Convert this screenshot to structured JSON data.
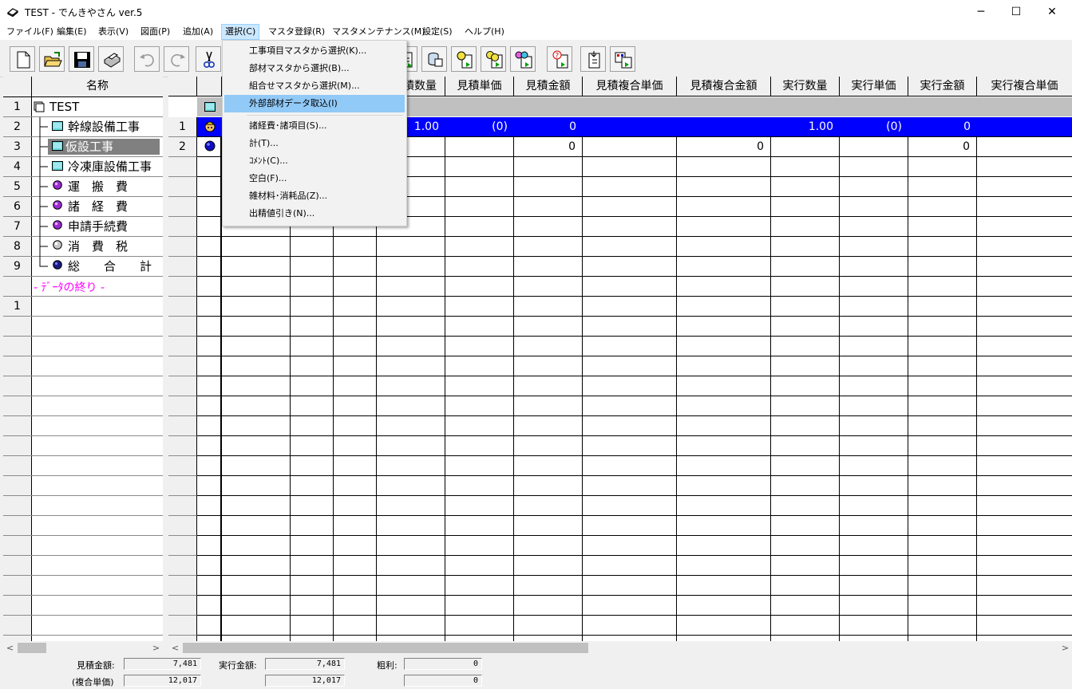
{
  "window": {
    "title": "TEST - でんきやさん ver.5",
    "controls": {
      "minimize": "─",
      "maximize": "☐",
      "close": "✕"
    }
  },
  "menubar": [
    {
      "label": "ファイル(F)"
    },
    {
      "label": "編集(E)"
    },
    {
      "label": "表示(V)"
    },
    {
      "label": "図面(P)"
    },
    {
      "label": "追加(A)"
    },
    {
      "label": "選択(C)"
    },
    {
      "label": "マスタ登録(R)"
    },
    {
      "label": "マスタメンテナンス(M)"
    },
    {
      "label": "設定(S)"
    },
    {
      "label": "ヘルプ(H)"
    }
  ],
  "dropdown": {
    "items": [
      "工事項目マスタから選択(K)...",
      "部材マスタから選択(B)...",
      "組合せマスタから選択(M)...",
      "外部部材データ取込(I)",
      "諸経費･諸項目(S)...",
      "計(T)...",
      "ｺﾒﾝﾄ(C)...",
      "空白(F)...",
      "雑材料･消耗品(Z)...",
      "出精値引き(N)..."
    ],
    "highlighted_index": 3
  },
  "tree": {
    "header": "名称",
    "rows": [
      {
        "num": "1",
        "label": "TEST",
        "icon": "document-icon"
      },
      {
        "num": "2",
        "label": "幹線設備工事",
        "icon": "folder-icon"
      },
      {
        "num": "3",
        "label": "仮設工事",
        "icon": "folder-icon",
        "selected": true
      },
      {
        "num": "4",
        "label": "冷凍庫設備工事",
        "icon": "folder-icon"
      },
      {
        "num": "5",
        "label": "運　搬　費",
        "icon": "purple-ball-icon"
      },
      {
        "num": "6",
        "label": "諸　経　費",
        "icon": "purple-ball-icon"
      },
      {
        "num": "7",
        "label": "申請手続費",
        "icon": "purple-ball-icon"
      },
      {
        "num": "8",
        "label": "消　費　税",
        "icon": "gray-ball-icon"
      },
      {
        "num": "9",
        "label": "総　　合　　計",
        "icon": "navy-ball-icon"
      }
    ],
    "end_label": "- ﾃﾞｰﾀの終り -",
    "after_rows": [
      "1"
    ]
  },
  "grid": {
    "columns": [
      "",
      "",
      "",
      "",
      "積数量",
      "見積単価",
      "見積金額",
      "見積複合単価",
      "見積複合金額",
      "実行数量",
      "実行単価",
      "実行金額",
      "実行複合単価"
    ],
    "rows": [
      {
        "num": "1",
        "selected": true,
        "cells": [
          "",
          "",
          "",
          "",
          "1.00",
          "(0)",
          "0",
          "",
          "",
          "1.00",
          "(0)",
          "0",
          ""
        ]
      },
      {
        "num": "2",
        "selected": false,
        "cells": [
          "",
          "",
          "",
          "",
          "",
          "",
          "0",
          "",
          "0",
          "",
          "",
          "0",
          ""
        ]
      }
    ]
  },
  "totals": {
    "estimate_label": "見積金額:",
    "estimate_value": "7,481",
    "composite_label": "(複合単価)",
    "composite_value": "12,017",
    "actual_label": "実行金額:",
    "actual_value": "7,481",
    "actual_composite_value": "12,017",
    "profit_label": "粗利:",
    "profit_value": "0",
    "profit_composite_value": "0"
  },
  "scroll": {
    "left_arrow": "<",
    "right_arrow": ">"
  }
}
